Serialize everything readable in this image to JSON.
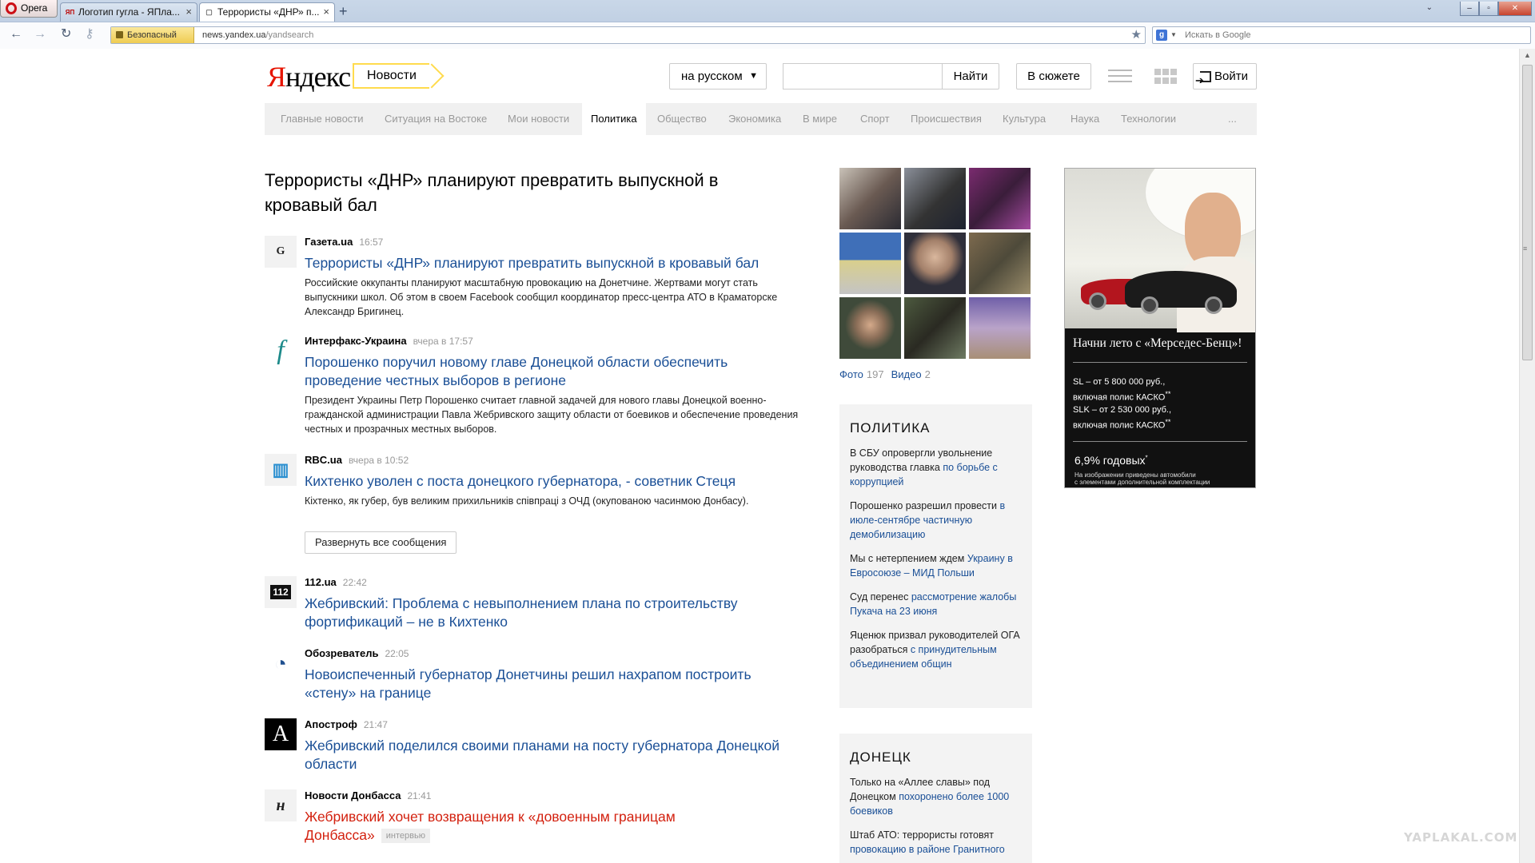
{
  "browser": {
    "opera_label": "Opera",
    "tabs": [
      {
        "favicon": "ЯП",
        "label": "Логотип гугла - ЯПла..."
      },
      {
        "favicon": "▢",
        "label": "Террористы «ДНР» п..."
      }
    ],
    "security_label": "Безопасный",
    "url_host": "news.yandex.ua",
    "url_path": "/yandsearch",
    "search_placeholder": "Искать в Google",
    "search_engine_letter": "g"
  },
  "header": {
    "logo_first": "Я",
    "logo_rest": "ндекс",
    "service": "Новости",
    "language": "на русском",
    "search_button": "Найти",
    "story_button": "В сюжете",
    "login": "Войти"
  },
  "rubrics": [
    "Главные новости",
    "Ситуация на Востоке",
    "Мои новости",
    "Политика",
    "Общество",
    "Экономика",
    "В мире",
    "Спорт",
    "Происшествия",
    "Культура",
    "Наука",
    "Технологии",
    "..."
  ],
  "headline": "Террористы «ДНР» планируют превратить выпускной в кровавый бал",
  "items": [
    {
      "icon": "G",
      "source": "Газета.ua",
      "time": "16:57",
      "title": "Террористы «ДНР» планируют превратить выпускной в кровавый бал",
      "snippet": "Российские оккупанты планируют масштабную провокацию на Донетчине. Жертвами могут стать выпускники школ. Об этом в своем Facebook сообщил координатор пресс-центра АТО в Краматорске Александр Бригинец."
    },
    {
      "icon": "f",
      "source": "Интерфакс-Украина",
      "time": "вчера в 17:57",
      "title": "Порошенко поручил новому главе Донецкой области обеспечить проведение честных выборов в регионе",
      "snippet": "Президент Украины Петр Порошенко считает главной задачей для нового главы Донецкой военно-гражданской администрации Павла Жебривского защиту области от боевиков и обеспечение проведения честных и прозрачных местных выборов."
    },
    {
      "icon": "▥",
      "source": "RBC.ua",
      "time": "вчера в 10:52",
      "title": "Кихтенко уволен с поста донецкого губернатора, - советник Стеця",
      "snippet": "Кіхтенко, як губер, був великим прихильників співпраці з ОЧД (окупованою часинмою Донбасу)."
    },
    {
      "icon": "112",
      "source": "112.ua",
      "time": "22:42",
      "title": "Жебривский: Проблема с невыполнением плана по строительству фортификаций – не в Кихтенко"
    },
    {
      "icon": "◔",
      "source": "Обозреватель",
      "time": "22:05",
      "title": "Новоиспеченный губернатор Донетчины решил нахрапом построить «стену» на границе"
    },
    {
      "icon": "A",
      "source": "Апостроф",
      "time": "21:47",
      "title": "Жебривский поделился своими планами на посту губернатора Донецкой области"
    },
    {
      "icon": "н",
      "source": "Новости Донбасса",
      "time": "21:41",
      "title_line1": "Жебривский хочет возвращения к «довоенным границам",
      "title_line2": "Донбасса»",
      "tag": "интервью"
    }
  ],
  "expand_button": "Развернуть все сообщения",
  "media": {
    "photo_label": "Фото",
    "photo_count": "197",
    "video_label": "Видео",
    "video_count": "2"
  },
  "panel_politics": {
    "title": "ПОЛИТИКА",
    "news": [
      {
        "plain": "В СБУ опровергли увольнение руководства главка ",
        "link": "по борьбе с коррупцией"
      },
      {
        "plain": "Порошенко разрешил провести ",
        "link": "в июле-сентябре частичную демобилизацию"
      },
      {
        "plain": "Мы с нетерпением ждем ",
        "link": "Украину в Евросоюзе – МИД Польши"
      },
      {
        "plain": "Суд перенес ",
        "link": "рассмотрение жалобы Пукача на 23 июня"
      },
      {
        "plain": "Яценюк призвал руководителей ОГА разобраться ",
        "link": "с принудительным объединением общин"
      }
    ]
  },
  "panel_donetsk": {
    "title": "ДОНЕЦК",
    "news": [
      {
        "plain": "Только на «Аллее славы» под Донецком ",
        "link": "похоронено более 1000 боевиков"
      },
      {
        "plain": "Штаб АТО: террористы готовят ",
        "link": "провокацию в районе Гранитного"
      }
    ]
  },
  "ad": {
    "headline": "Начни лето с «Мерседес-Бенц»!",
    "line1": "SL – от 5 800 000 руб.,",
    "line2": " включая полис КАСКО",
    "line3": "SLK – от 2 530 000 руб.,",
    "line4": " включая полис КАСКО",
    "rate": "6,9% годовых",
    "note1": "На изображении приведены автомобили",
    "note2": "с элементами дополнительной комплектации"
  },
  "watermark": "YAPLAKAL.COM"
}
